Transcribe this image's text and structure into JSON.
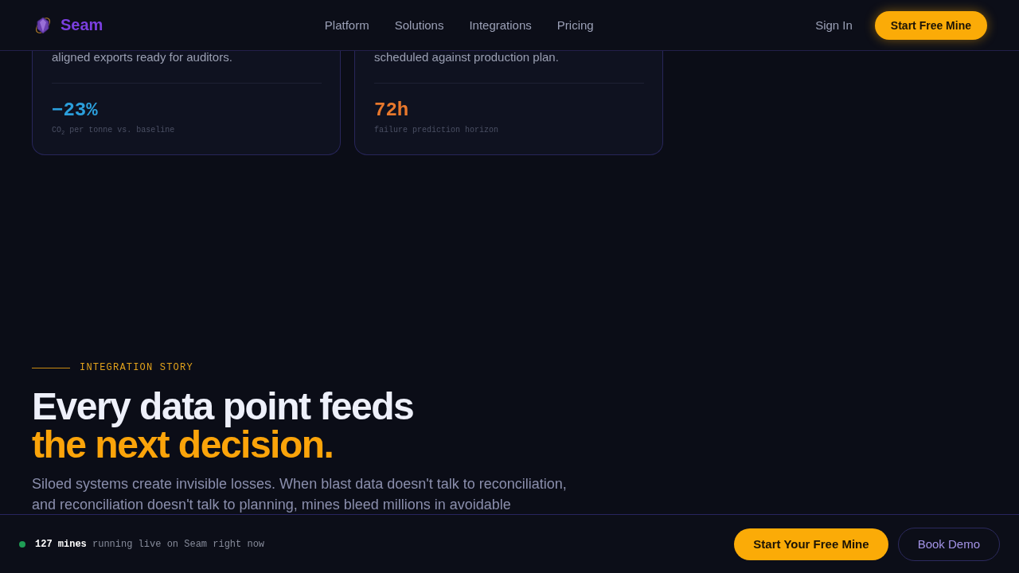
{
  "header": {
    "brand": "Seam",
    "nav": [
      "Platform",
      "Solutions",
      "Integrations",
      "Pricing"
    ],
    "sign_in": "Sign In",
    "cta": "Start Free Mine"
  },
  "cards": [
    {
      "text": "aligned exports ready for auditors.",
      "metric": "−23%",
      "color": "#2b9fdc",
      "caption": "CO$_{2}$ per tonne vs. baseline"
    },
    {
      "text": "scheduled against production plan.",
      "metric": "72h",
      "color": "#e8782c",
      "caption": "failure prediction horizon"
    }
  ],
  "section": {
    "eyebrow": "INTEGRATION STORY",
    "heading": "Every data point feeds",
    "heading_accent": "the next decision.",
    "body": "Siloed systems create invisible losses. When blast data doesn't talk to reconciliation, and reconciliation doesn't talk to planning, mines bleed millions in avoidable"
  },
  "live_bar": {
    "text": "**127 mines** running live on Seam right now",
    "buttons": [
      {
        "label": "Start Your Free Mine",
        "kind": "primary"
      },
      {
        "label": "Book Demo",
        "kind": "secondary"
      }
    ]
  }
}
